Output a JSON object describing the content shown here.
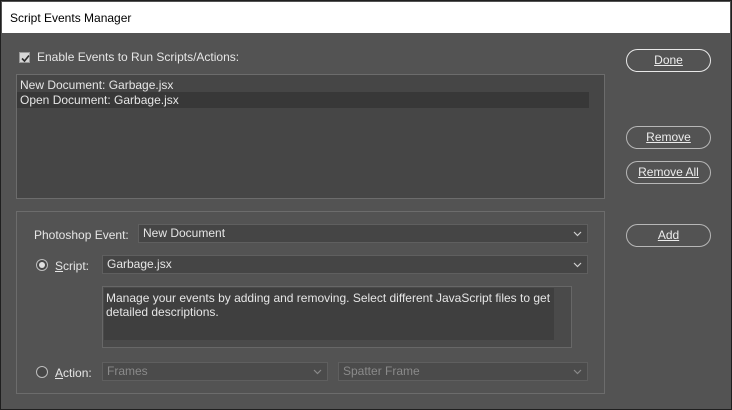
{
  "window": {
    "title": "Script Events Manager"
  },
  "enable": {
    "label": "Enable Events to Run Scripts/Actions:",
    "checked": true
  },
  "events": [
    {
      "label": "New Document: Garbage.jsx",
      "selected": false
    },
    {
      "label": "Open Document: Garbage.jsx",
      "selected": true
    }
  ],
  "detail": {
    "photoshop_event_label": "Photoshop Event:",
    "photoshop_event_value": "New Document",
    "script_label": "Script:",
    "script_value": "Garbage.jsx",
    "script_selected": true,
    "description": "Manage your events by adding and removing. Select different JavaScript files to get detailed descriptions.",
    "action_label": "Action:",
    "action_set_value": "Frames",
    "action_value": "Spatter Frame"
  },
  "buttons": {
    "done": "Done",
    "remove": "Remove",
    "remove_all": "Remove All",
    "add": "Add"
  }
}
